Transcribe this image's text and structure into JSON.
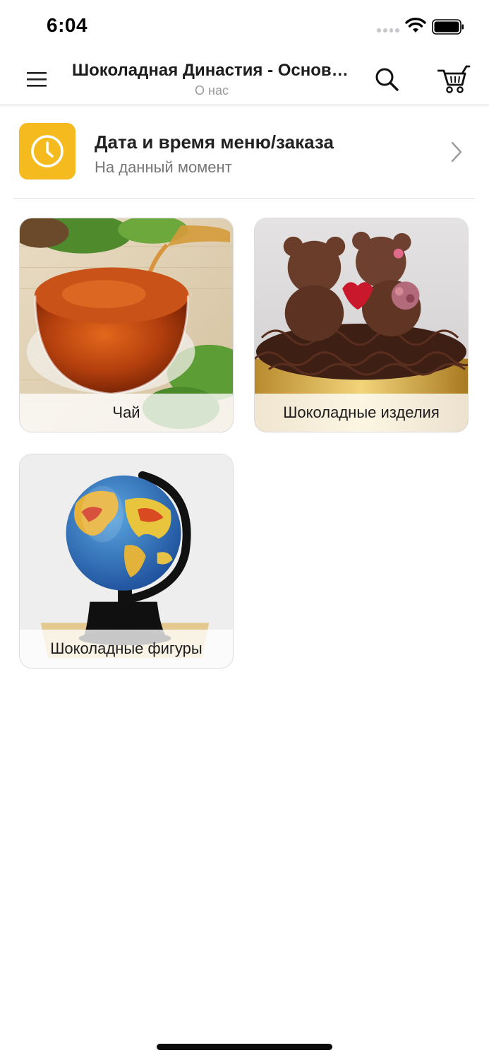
{
  "status_bar": {
    "time": "6:04"
  },
  "header": {
    "title": "Шоколадная Династия - Основ…",
    "subtitle": "О нас",
    "menu_icon": "hamburger-icon",
    "search_icon": "search-icon",
    "cart_icon": "cart-icon"
  },
  "order_time": {
    "title": "Дата и время меню/заказа",
    "subtitle": "На данный момент",
    "icon": "clock-icon",
    "accent_color": "#f5ba1e"
  },
  "categories": [
    {
      "label": "Чай",
      "image": "tea-cup-image"
    },
    {
      "label": "Шоколадные изделия",
      "image": "chocolate-bears-image"
    },
    {
      "label": "Шоколадные фигуры",
      "image": "chocolate-globe-image"
    }
  ]
}
